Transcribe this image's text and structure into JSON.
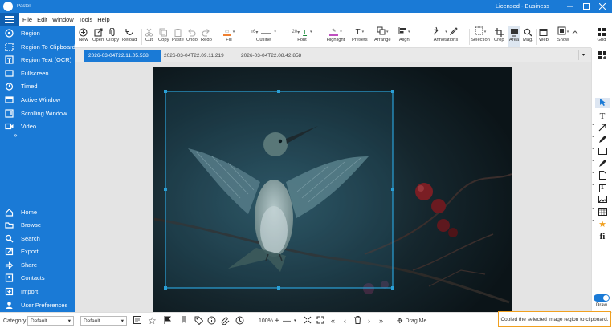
{
  "app": {
    "title": "Pastel",
    "license": "Licensed - Business",
    "colors": {
      "accent": "#1a7ad6"
    }
  },
  "menu": [
    "File",
    "Edit",
    "Window",
    "Tools",
    "Help"
  ],
  "sidebar": {
    "top": [
      {
        "label": "Region",
        "icon": "region-icon"
      },
      {
        "label": "Region To Clipboard",
        "icon": "clipboard-region-icon"
      },
      {
        "label": "Region Text (OCR)",
        "icon": "ocr-icon"
      },
      {
        "label": "Fullscreen",
        "icon": "fullscreen-icon"
      },
      {
        "label": "Timed",
        "icon": "timer-icon"
      },
      {
        "label": "Active Window",
        "icon": "window-icon"
      },
      {
        "label": "Scrolling Window",
        "icon": "scroll-window-icon"
      },
      {
        "label": "Video",
        "icon": "video-icon"
      }
    ],
    "more": "»",
    "bottom": [
      {
        "label": "Home",
        "icon": "home-icon"
      },
      {
        "label": "Browse",
        "icon": "browse-icon"
      },
      {
        "label": "Search",
        "icon": "search-icon"
      },
      {
        "label": "Export",
        "icon": "export-icon"
      },
      {
        "label": "Share",
        "icon": "share-icon"
      },
      {
        "label": "Contacts",
        "icon": "contacts-icon"
      },
      {
        "label": "Import",
        "icon": "import-icon"
      },
      {
        "label": "User Preferences",
        "icon": "user-icon"
      }
    ]
  },
  "toolbar": {
    "new": "New",
    "open": "Open",
    "clippy": "Clippy",
    "reload": "Reload",
    "cut": "Cut",
    "copy": "Copy",
    "paste": "Paste",
    "undo": "Undo",
    "redo": "Redo",
    "fill": "Fill",
    "outline": "Outline",
    "outline_size": "6",
    "font": "Font",
    "font_size": "20",
    "highlight": "Highlight",
    "presets": "Presets",
    "arrange": "Arrange",
    "align": "Align",
    "annotations": "Annotations",
    "selection": "Selection",
    "crop": "Crop",
    "area": "Area",
    "mag": "Mag.",
    "web": "Web",
    "show": "Show",
    "grid": "Grid",
    "fill_color": "#f08030",
    "outline_color": "#909090",
    "highlight_color": "#c050c0"
  },
  "tabs": [
    "2026-03-04T22.11.05.538",
    "2026-03-04T22.09.11.219",
    "2026-03-04T22.08.42.858"
  ],
  "right_tools": {
    "draw": "Draw",
    "icons": [
      "select-icon",
      "text-icon",
      "arrow-icon",
      "pencil-icon",
      "rectangle-icon",
      "marker-icon",
      "note-icon",
      "step-number-icon",
      "image-icon",
      "blur-icon",
      "star-icon",
      "fi-icon"
    ],
    "text_glyph": "T",
    "step_glyph": "1",
    "fi_glyph": "fi"
  },
  "status": {
    "category_label": "Category",
    "category_value": "Default",
    "tag_value": "Default",
    "zoom": "100%",
    "drag_me": "Drag Me",
    "message": "Copied the selected image region to clipboard."
  }
}
